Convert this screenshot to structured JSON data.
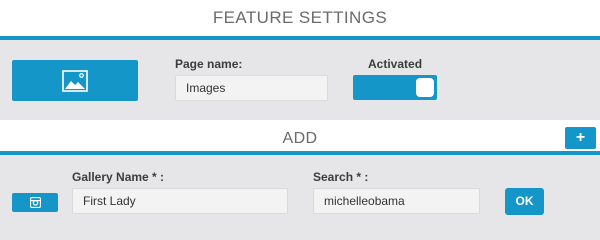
{
  "header": {
    "title": "FEATURE SETTINGS"
  },
  "settings": {
    "image_tile_icon": "image-icon",
    "page_name": {
      "label": "Page name:",
      "value": "Images"
    },
    "activated": {
      "label": "Activated",
      "on": true
    }
  },
  "add_section": {
    "title": "ADD",
    "plus_label": "+",
    "source_icon": "instagram-icon",
    "gallery_name": {
      "label": "Gallery Name * :",
      "value": "First Lady"
    },
    "search": {
      "label": "Search * :",
      "value": "michelleobama"
    },
    "ok_label": "OK"
  },
  "colors": {
    "accent": "#1496c8",
    "panel_background": "#e6e6e8",
    "field_background": "#f3f3f4"
  }
}
